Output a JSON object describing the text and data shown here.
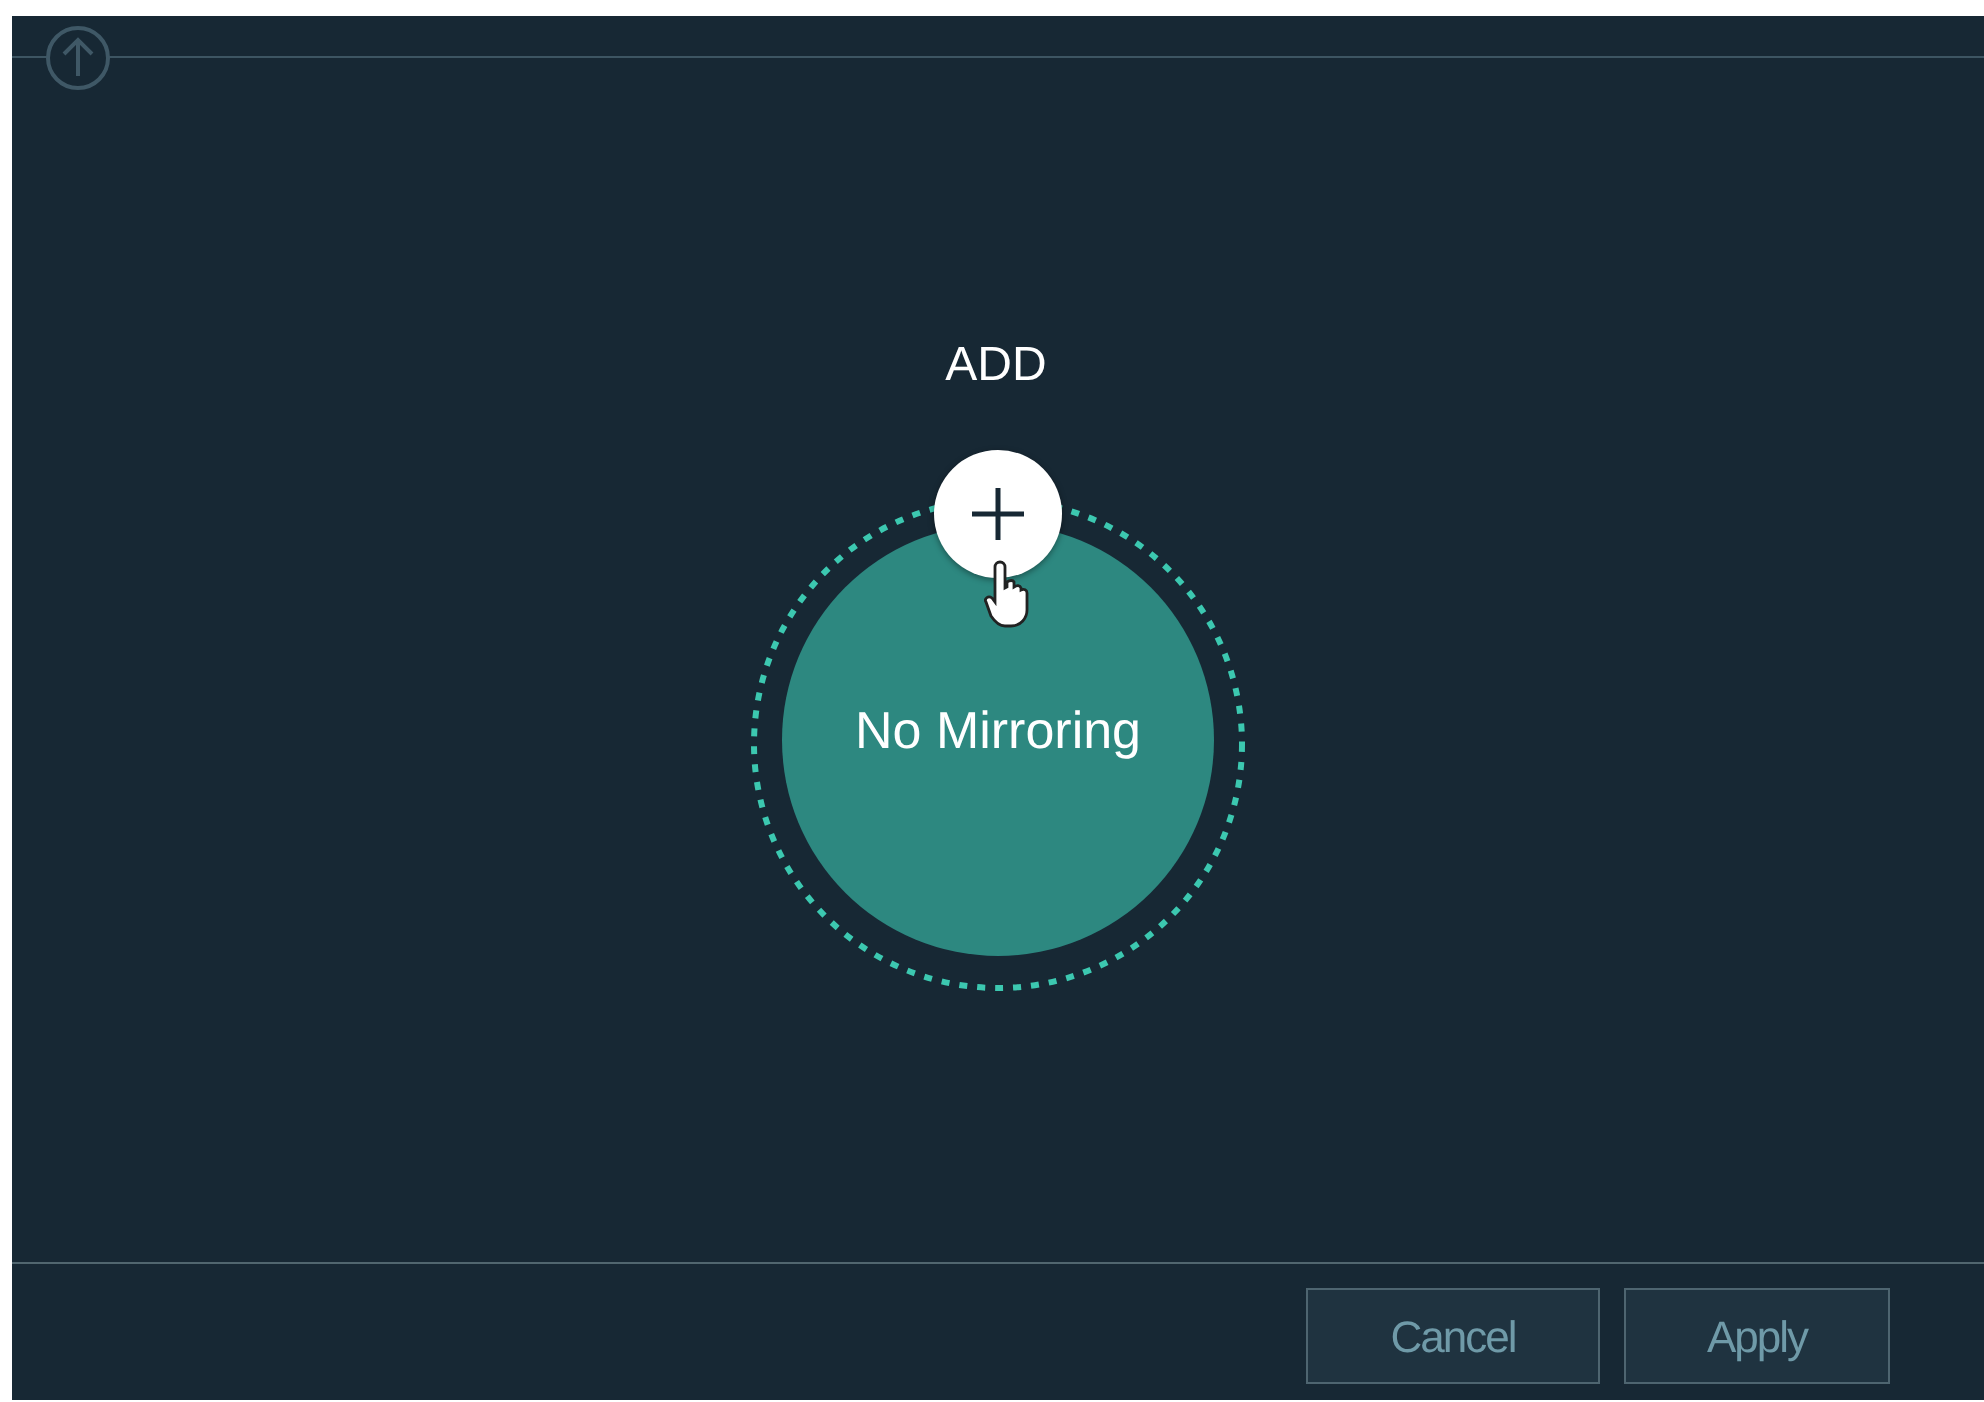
{
  "add_label": "ADD",
  "mirror_node": {
    "label": "No Mirroring"
  },
  "buttons": [
    {
      "label": "Cancel"
    },
    {
      "label": "Apply"
    }
  ]
}
